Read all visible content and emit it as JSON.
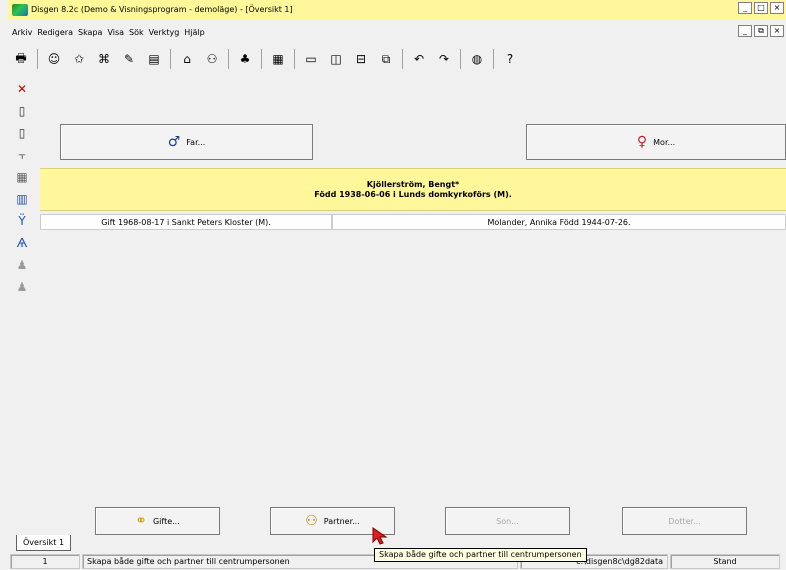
{
  "window": {
    "title": "Disgen 8.2c (Demo & Visningsprogram - demoläge) - [Översikt 1]",
    "title_controls": [
      "_",
      "□",
      "×"
    ],
    "mdi_controls": [
      "_",
      "⧉",
      "×"
    ]
  },
  "menu": {
    "items": [
      "Arkiv",
      "Redigera",
      "Skapa",
      "Visa",
      "Sök",
      "Verktyg",
      "Hjälp"
    ]
  },
  "toolbar": {
    "buttons": [
      {
        "name": "print-icon",
        "glyph": "🖶"
      },
      {
        "name": "face-icon",
        "glyph": "☺"
      },
      {
        "name": "star-person-icon",
        "glyph": "✩"
      },
      {
        "name": "binoculars-icon",
        "glyph": "⌘"
      },
      {
        "name": "document-edit-icon",
        "glyph": "✎"
      },
      {
        "name": "books-icon",
        "glyph": "▤"
      },
      {
        "name": "home-icon",
        "glyph": "⌂"
      },
      {
        "name": "family-icon",
        "glyph": "⚇"
      },
      {
        "name": "tree-icon",
        "glyph": "♣"
      },
      {
        "name": "calendar-icon",
        "glyph": "▦"
      },
      {
        "name": "window-single-icon",
        "glyph": "▭"
      },
      {
        "name": "window-split-v-icon",
        "glyph": "◫"
      },
      {
        "name": "window-split-h-icon",
        "glyph": "⊟"
      },
      {
        "name": "window-cascade-icon",
        "glyph": "⧉"
      },
      {
        "name": "undo-icon",
        "glyph": "↶"
      },
      {
        "name": "redo-icon",
        "glyph": "↷"
      },
      {
        "name": "globe-icon",
        "glyph": "◍"
      },
      {
        "name": "help-icon",
        "glyph": "?"
      }
    ]
  },
  "side_toolbar": {
    "buttons": [
      {
        "name": "delete-icon",
        "glyph": "✕"
      },
      {
        "name": "document-icon",
        "glyph": "▯"
      },
      {
        "name": "page-icon",
        "glyph": "▯"
      },
      {
        "name": "tree-branch-icon",
        "glyph": "⫟"
      },
      {
        "name": "table-icon",
        "glyph": "▦"
      },
      {
        "name": "columns-icon",
        "glyph": "▥"
      },
      {
        "name": "ancestors-icon",
        "glyph": "Ÿ"
      },
      {
        "name": "descendants-icon",
        "glyph": "Ѧ"
      },
      {
        "name": "people-up-icon",
        "glyph": "♟"
      },
      {
        "name": "people-down-icon",
        "glyph": "♟"
      }
    ]
  },
  "main": {
    "father_button": "Far...",
    "mother_button": "Mor...",
    "person": {
      "name": "Kjöllerström, Bengt*",
      "birth": "Född 1938-06-06 i Lunds domkyrkoförs (M)."
    },
    "marriage": {
      "event": "Gift 1968-08-17 i Sankt Peters Kloster (M).",
      "partner": "Molander, Annika Född 1944-07-26."
    },
    "bottom_buttons": {
      "gifte": "Gifte...",
      "partner": "Partner...",
      "son": "Son...",
      "dotter": "Dotter..."
    }
  },
  "tabs": {
    "active": "Översikt 1"
  },
  "status_bar": {
    "index": "1",
    "message": "Skapa både gifte och partner till centrumpersonen",
    "path": "c:\\disgen8c\\dg82data",
    "mode": "Stand"
  },
  "tooltip": {
    "text": "Skapa både gifte och partner till centrumpersonen"
  },
  "colors": {
    "highlight": "#fff79a",
    "father": "#1a3a8a",
    "mother": "#c0262c"
  }
}
